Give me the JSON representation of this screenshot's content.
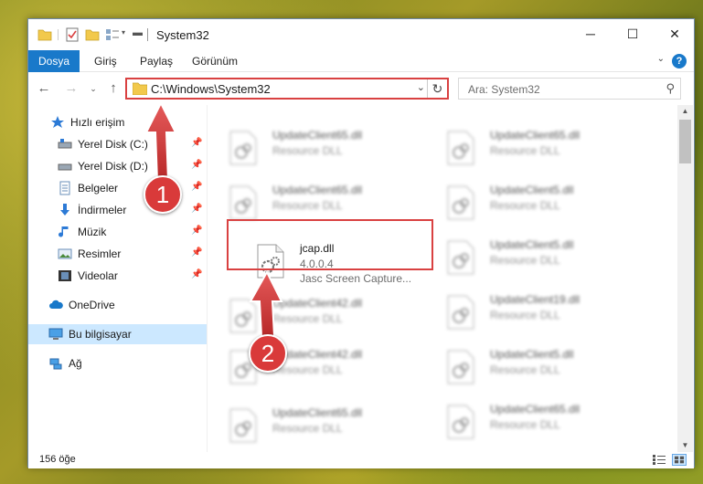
{
  "window": {
    "title": "System32"
  },
  "ribbon": {
    "tabs": [
      {
        "label": "Dosya"
      },
      {
        "label": "Giriş"
      },
      {
        "label": "Paylaş"
      },
      {
        "label": "Görünüm"
      }
    ],
    "help": "?"
  },
  "address": {
    "path": "C:\\Windows\\System32"
  },
  "search": {
    "placeholder": "Ara: System32"
  },
  "sidebar": {
    "items": [
      {
        "label": "Hızlı erişim",
        "icon": "star-icon"
      },
      {
        "label": "Yerel Disk (C:)",
        "icon": "drive-icon"
      },
      {
        "label": "Yerel Disk (D:)",
        "icon": "drive-icon"
      },
      {
        "label": "Belgeler",
        "icon": "document-icon"
      },
      {
        "label": "İndirmeler",
        "icon": "download-icon"
      },
      {
        "label": "Müzik",
        "icon": "music-icon"
      },
      {
        "label": "Resimler",
        "icon": "pictures-icon"
      },
      {
        "label": "Videolar",
        "icon": "video-icon"
      },
      {
        "label": "OneDrive",
        "icon": "cloud-icon"
      },
      {
        "label": "Bu bilgisayar",
        "icon": "computer-icon"
      },
      {
        "label": "Ağ",
        "icon": "network-icon"
      }
    ]
  },
  "files": {
    "left": [
      {
        "name": "UpdateClient65.dll",
        "sub": "Resource DLL"
      },
      {
        "name": "UpdateClient65.dll",
        "sub": "Resource DLL"
      },
      {
        "name": "jcap.dll",
        "sub": "4.0.0.4",
        "sub2": "Jasc Screen Capture..."
      },
      {
        "name": "UpdateClient42.dll",
        "sub": "Resource DLL"
      },
      {
        "name": "UpdateClient42.dll",
        "sub": "Resource DLL"
      },
      {
        "name": "UpdateClient65.dll",
        "sub": "Resource DLL"
      }
    ],
    "right": [
      {
        "name": "UpdateClient65.dll",
        "sub": "Resource DLL"
      },
      {
        "name": "UpdateClient5.dll",
        "sub": "Resource DLL"
      },
      {
        "name": "UpdateClient5.dll",
        "sub": "Resource DLL"
      },
      {
        "name": "UpdateClient19.dll",
        "sub": "Resource DLL"
      },
      {
        "name": "UpdateClient5.dll",
        "sub": "Resource DLL"
      },
      {
        "name": "UpdateClient65.dll",
        "sub": "Resource DLL"
      }
    ]
  },
  "status": {
    "count": "156 öğe"
  },
  "annotations": {
    "step1": "1",
    "step2": "2"
  },
  "colors": {
    "accent": "#1979ca",
    "annotation": "#d94141",
    "selected": "#cce8ff"
  }
}
